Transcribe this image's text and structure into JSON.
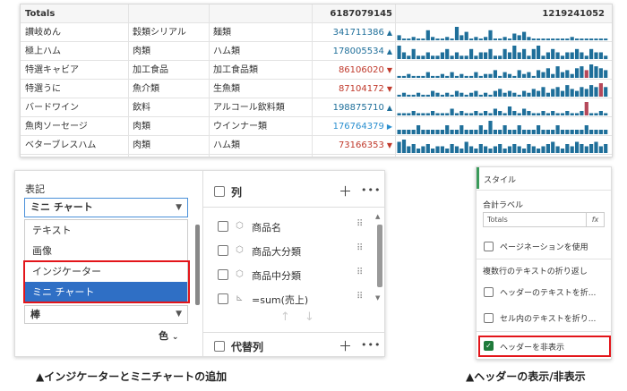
{
  "table": {
    "header": {
      "label": "Totals",
      "total": "6187079145",
      "sparkline_total": "1219241052"
    },
    "rows": [
      {
        "name": "讃岐めん",
        "cat": "穀類シリアル",
        "sub": "麺類",
        "value": "341711386",
        "dir": "up",
        "color": "#1f6f9a",
        "bars": [
          3,
          1,
          1,
          2,
          1,
          1,
          6,
          2,
          1,
          1,
          2,
          1,
          8,
          3,
          5,
          1,
          2,
          1,
          2,
          6,
          1,
          1,
          2,
          1,
          4,
          3,
          5,
          2,
          1,
          1,
          1,
          1,
          1,
          1,
          1,
          1,
          2,
          1,
          1,
          1,
          1,
          1,
          1,
          1
        ],
        "red_index": []
      },
      {
        "name": "極上ハム",
        "cat": "肉類",
        "sub": "ハム類",
        "value": "178005534",
        "dir": "up",
        "color": "#1f6f9a",
        "bars": [
          4,
          2,
          1,
          3,
          1,
          1,
          2,
          1,
          1,
          2,
          3,
          1,
          2,
          1,
          1,
          3,
          1,
          2,
          2,
          3,
          1,
          1,
          3,
          2,
          4,
          2,
          3,
          1,
          3,
          4,
          1,
          2,
          3,
          2,
          1,
          2,
          2,
          3,
          2,
          1,
          3,
          2,
          2,
          1
        ],
        "red_index": []
      },
      {
        "name": "特選キャビア",
        "cat": "加工食品",
        "sub": "加工食品類",
        "value": "86106020",
        "dir": "down",
        "color": "#c0392b",
        "bars": [
          1,
          1,
          2,
          1,
          1,
          1,
          3,
          1,
          1,
          2,
          1,
          3,
          1,
          2,
          1,
          1,
          3,
          1,
          2,
          2,
          4,
          1,
          3,
          2,
          1,
          4,
          2,
          3,
          1,
          4,
          3,
          5,
          2,
          6,
          3,
          4,
          2,
          5,
          6,
          4,
          7,
          6,
          5,
          4
        ],
        "red_index": [
          39
        ]
      },
      {
        "name": "特選うに",
        "cat": "魚介類",
        "sub": "生魚類",
        "value": "87104172",
        "dir": "down",
        "color": "#c0392b",
        "bars": [
          1,
          2,
          1,
          1,
          2,
          1,
          1,
          3,
          2,
          1,
          2,
          1,
          3,
          2,
          1,
          2,
          3,
          1,
          2,
          1,
          3,
          4,
          2,
          3,
          2,
          1,
          3,
          2,
          4,
          3,
          5,
          2,
          4,
          5,
          3,
          6,
          4,
          3,
          5,
          4,
          6,
          5,
          7,
          5
        ],
        "red_index": [
          42
        ]
      },
      {
        "name": "バードワイン",
        "cat": "飲料",
        "sub": "アルコール飲料類",
        "value": "198875710",
        "dir": "up",
        "color": "#1f6f9a",
        "bars": [
          1,
          1,
          1,
          2,
          1,
          1,
          1,
          2,
          1,
          1,
          1,
          3,
          1,
          2,
          1,
          1,
          2,
          1,
          2,
          1,
          3,
          2,
          1,
          4,
          2,
          1,
          3,
          2,
          1,
          1,
          2,
          1,
          2,
          1,
          1,
          2,
          1,
          1,
          2,
          6,
          1,
          1,
          2,
          1
        ],
        "red_index": [
          39
        ]
      },
      {
        "name": "魚肉ソーセージ",
        "cat": "肉類",
        "sub": "ウインナー類",
        "value": "176764379",
        "dir": "right",
        "color": "#2a8fcf",
        "bars": [
          1,
          1,
          1,
          1,
          2,
          1,
          1,
          1,
          1,
          1,
          2,
          1,
          1,
          2,
          1,
          1,
          1,
          2,
          1,
          3,
          1,
          1,
          2,
          1,
          1,
          2,
          1,
          1,
          1,
          2,
          1,
          1,
          1,
          2,
          1,
          1,
          1,
          1,
          1,
          2,
          1,
          1,
          1,
          1
        ],
        "red_index": []
      },
      {
        "name": "ベターブレスハム",
        "cat": "肉類",
        "sub": "ハム類",
        "value": "73166353",
        "dir": "down",
        "color": "#c0392b",
        "bars": [
          5,
          6,
          3,
          4,
          2,
          3,
          4,
          2,
          3,
          3,
          2,
          4,
          3,
          2,
          5,
          3,
          2,
          4,
          3,
          2,
          3,
          4,
          2,
          3,
          4,
          3,
          2,
          4,
          3,
          2,
          3,
          4,
          5,
          3,
          2,
          4,
          3,
          5,
          4,
          3,
          4,
          5,
          3,
          4
        ],
        "red_index": []
      }
    ]
  },
  "panel1": {
    "label": "表記",
    "dropdown_value": "ミニ チャート",
    "options": [
      "テキスト",
      "画像",
      "インジケーター",
      "ミニ チャート"
    ],
    "bar_value": "棒",
    "color_label": "色",
    "columns_header": "列",
    "fields": [
      "商品名",
      "商品大分類",
      "商品中分類",
      "=sum(売上)"
    ],
    "alt_columns_header": "代替列"
  },
  "panel2": {
    "style_label": "スタイル",
    "total_label_title": "合計ラベル",
    "total_label_value": "Totals",
    "fx": "fx",
    "pagination": "ページネーションを使用",
    "wrap_title": "複数行のテキストの折り返し",
    "wrap_header": "ヘッダーのテキストを折...",
    "wrap_cell": "セル内のテキストを折り...",
    "hide_header": "ヘッダーを非表示"
  },
  "captions": {
    "left": "▲インジケーターとミニチャートの追加",
    "right": "▲ヘッダーの表示/非表示"
  }
}
